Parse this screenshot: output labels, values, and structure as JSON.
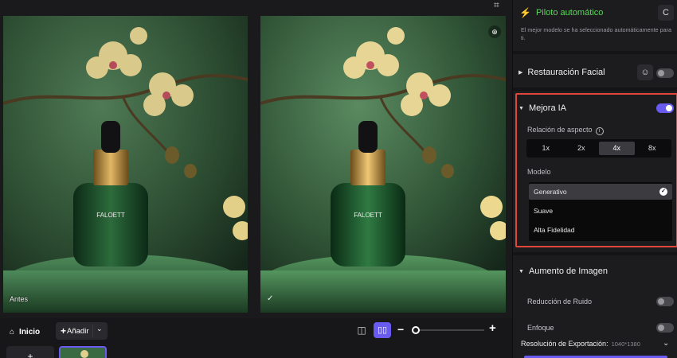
{
  "canvas": {
    "before_label": "Antes",
    "after_check": "✓",
    "product_brand": "FALOETT"
  },
  "bottombar": {
    "home_label": "Inicio",
    "add_label": "Añadir"
  },
  "sidebar": {
    "autopilot": {
      "title": "Piloto automático",
      "description": "El mejor modelo se ha seleccionado automáticamente para ti."
    },
    "face_restore": {
      "title": "Restauración Facial",
      "enabled": false
    },
    "ai_enhance": {
      "title": "Mejora IA",
      "enabled": true,
      "aspect_label": "Relación de aspecto",
      "aspect_options": [
        "1x",
        "2x",
        "4x",
        "8x"
      ],
      "aspect_selected": "4x",
      "model_label": "Modelo",
      "models": [
        "Generativo",
        "Suave",
        "Alta Fidelidad"
      ],
      "model_selected": "Generativo"
    },
    "image_augment": {
      "title": "Aumento de Imagen",
      "noise_reduction_label": "Reducción de Ruido",
      "noise_reduction_enabled": false,
      "sharpen_label": "Enfoque",
      "sharpen_enabled": false
    },
    "export": {
      "label": "Resolución de Exportación:",
      "value": "1040*1380"
    }
  },
  "colors": {
    "accent": "#6a5bf0",
    "autopilot_green": "#5fd35f",
    "highlight_red": "#e0463a"
  }
}
